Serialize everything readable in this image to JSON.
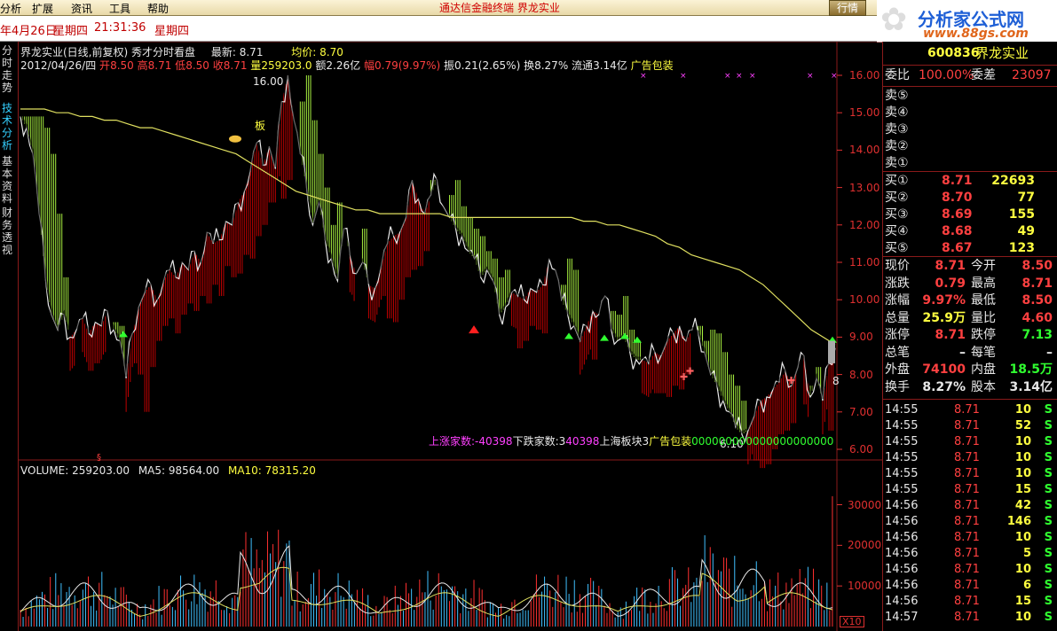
{
  "menu": {
    "items": [
      "分析",
      "扩展",
      "资讯",
      "工具",
      "帮助"
    ],
    "center_title": "通达信金融终端 界龙实业",
    "quote_button": "行情"
  },
  "statusbar": {
    "date": "年4月26日",
    "weekday": "星期四",
    "time": "21:31:36",
    "weekday2": "星期四"
  },
  "logo": {
    "title": "分析家公式网",
    "url": "www.88gs.com"
  },
  "left_tabs": [
    {
      "label": "分时走势",
      "active": false
    },
    {
      "label": "技术分析",
      "active": true
    },
    {
      "label": "基本资料",
      "active": false
    },
    {
      "label": "财务透视",
      "active": false
    }
  ],
  "chart_header": {
    "line1": {
      "name": "界龙实业(日线,前复权)",
      "indicator": "秀才分时看盘",
      "latest_label": "最新:",
      "latest": "8.71",
      "avg_label": "均价:",
      "avg": "8.70"
    },
    "line2": {
      "date": "2012/04/26/四",
      "open_label": "开",
      "open": "8.50",
      "high_label": "高",
      "high": "8.71",
      "low_label": "低",
      "low": "8.50",
      "close_label": "收",
      "close": "8.71",
      "vol_label": "量",
      "vol": "259203.0",
      "amt_label": "额",
      "amt": "2.26亿",
      "chg_label": "幅",
      "chg": "0.79(9.97%)",
      "amp_label": "振",
      "amp": "0.21(2.65%)",
      "turn_label": "换",
      "turn": "8.27%",
      "float_label": "流通",
      "float": "3.14亿",
      "sector": "广告包装"
    }
  },
  "chart_labels": {
    "peak": "16.00",
    "trough": "6.10",
    "last_right": "8",
    "board": "板",
    "bottom_text": "上涨家数:-403981 下跌家数:-403981 上海板块:-4039817 广告包装:000000000000000",
    "bottom_parts": [
      "上涨家数:-40398",
      "下跌家数:3",
      "40398",
      "上海板块",
      "3",
      "广告包装",
      "000000",
      "000000000000000"
    ]
  },
  "price_axis": [
    "16.00",
    "15.00",
    "14.00",
    "13.00",
    "12.00",
    "11.00",
    "10.00",
    "9.00",
    "8.00",
    "7.00",
    "6.00"
  ],
  "volume_header": {
    "vol": "VOLUME: 259203.00",
    "ma5": "MA5: 98564.00",
    "ma10": "MA10: 78315.20"
  },
  "volume_axis": [
    "30000",
    "20000",
    "10000"
  ],
  "volume_unit": "X10",
  "chart_data": {
    "type": "line",
    "title": "界龙实业(日线,前复权)",
    "ylim": [
      5.8,
      16.2
    ],
    "close_path": [
      14.9,
      14.6,
      13.9,
      12.3,
      10.6,
      9.6,
      9.2,
      9.6,
      9.0,
      9.2,
      9.5,
      9.1,
      9.4,
      9.3,
      9.7,
      9.2,
      8.9,
      7.9,
      9.1,
      9.8,
      10.2,
      10.4,
      10.0,
      10.5,
      10.8,
      10.6,
      11.0,
      10.8,
      11.3,
      11.0,
      11.8,
      11.5,
      11.6,
      12.1,
      12.0,
      12.6,
      12.9,
      13.5,
      14.2,
      13.6,
      14.1,
      13.5,
      15.3,
      16.0,
      14.8,
      13.9,
      13.0,
      12.0,
      12.6,
      11.6,
      11.1,
      10.5,
      11.9,
      11.2,
      10.7,
      11.0,
      10.4,
      10.3,
      10.9,
      11.5,
      11.7,
      11.8,
      12.2,
      13.2,
      12.7,
      12.3,
      12.8,
      13.2,
      12.5,
      12.2,
      11.9,
      11.7,
      11.3,
      11.1,
      10.6,
      10.8,
      10.5,
      9.6,
      9.8,
      10.2,
      10.1,
      10.0,
      10.3,
      10.2,
      10.4,
      11.1,
      10.8,
      10.0,
      9.6,
      9.3,
      8.9,
      9.3,
      9.7,
      9.6,
      10.1,
      9.2,
      8.9,
      9.0,
      8.6,
      8.4,
      8.4,
      8.3,
      8.6,
      8.5,
      8.9,
      9.1,
      9.3,
      8.9,
      9.2,
      9.1,
      8.6,
      8.0,
      7.7,
      7.3,
      7.0,
      6.6,
      6.4,
      6.5,
      6.9,
      7.3,
      7.4,
      7.6,
      7.8,
      8.1,
      7.7,
      8.2,
      8.5,
      7.4,
      7.9,
      7.3,
      8.3,
      8.71
    ],
    "ma_path": [
      15.1,
      15.1,
      15.1,
      15.0,
      15.0,
      14.9,
      14.9,
      14.8,
      14.8,
      14.7,
      14.6,
      14.6,
      14.5,
      14.4,
      14.3,
      14.2,
      14.1,
      14.0,
      13.9,
      13.7,
      13.5,
      13.3,
      13.1,
      12.9,
      12.8,
      12.7,
      12.6,
      12.5,
      12.4,
      12.4,
      12.3,
      12.3,
      12.3,
      12.3,
      12.3,
      12.3,
      12.2,
      12.2,
      12.2,
      12.2,
      12.2,
      12.2,
      12.2,
      12.2,
      12.2,
      12.2,
      12.2,
      12.1,
      12.1,
      12.0,
      12.0,
      11.9,
      11.8,
      11.7,
      11.5,
      11.4,
      11.2,
      11.1,
      11.0,
      10.9,
      10.8,
      10.6,
      10.4,
      10.1,
      9.8,
      9.5,
      9.2,
      9.0,
      8.8
    ],
    "volume_ylim": [
      0,
      36000
    ],
    "markers": {
      "buy_arrows": [
        "green"
      ],
      "sell_flags": [
        "red"
      ]
    }
  },
  "right_panel": {
    "code": "600836",
    "name": "界龙实业",
    "wei_bi_label": "委比",
    "wei_bi": "100.00%",
    "wei_cha_label": "委差",
    "wei_cha": "23097",
    "sells": [
      {
        "label": "卖⑤",
        "price": "",
        "vol": ""
      },
      {
        "label": "卖④",
        "price": "",
        "vol": ""
      },
      {
        "label": "卖③",
        "price": "",
        "vol": ""
      },
      {
        "label": "卖②",
        "price": "",
        "vol": ""
      },
      {
        "label": "卖①",
        "price": "",
        "vol": ""
      }
    ],
    "buys": [
      {
        "label": "买①",
        "price": "8.71",
        "vol": "22693"
      },
      {
        "label": "买②",
        "price": "8.70",
        "vol": "77"
      },
      {
        "label": "买③",
        "price": "8.69",
        "vol": "155"
      },
      {
        "label": "买④",
        "price": "8.68",
        "vol": "49"
      },
      {
        "label": "买⑤",
        "price": "8.67",
        "vol": "123"
      }
    ],
    "stats": [
      {
        "l1": "现价",
        "v1": "8.71",
        "c1": "red",
        "l2": "今开",
        "v2": "8.50",
        "c2": "red"
      },
      {
        "l1": "涨跌",
        "v1": "0.79",
        "c1": "red",
        "l2": "最高",
        "v2": "8.71",
        "c2": "red"
      },
      {
        "l1": "涨幅",
        "v1": "9.97%",
        "c1": "red",
        "l2": "最低",
        "v2": "8.50",
        "c2": "red"
      },
      {
        "l1": "总量",
        "v1": "25.9万",
        "c1": "yellow",
        "l2": "量比",
        "v2": "4.60",
        "c2": "red"
      },
      {
        "l1": "涨停",
        "v1": "8.71",
        "c1": "red",
        "l2": "跌停",
        "v2": "7.13",
        "c2": "green"
      },
      {
        "l1": "总笔",
        "v1": "–",
        "c1": "white",
        "l2": "每笔",
        "v2": "–",
        "c2": "white"
      },
      {
        "l1": "外盘",
        "v1": "74100",
        "c1": "red",
        "l2": "内盘",
        "v2": "18.5万",
        "c2": "green"
      },
      {
        "l1": "换手",
        "v1": "8.27%",
        "c1": "white",
        "l2": "股本",
        "v2": "3.14亿",
        "c2": "white"
      }
    ],
    "ticks": [
      {
        "t": "14:55",
        "p": "8.71",
        "v": "10",
        "s": "S"
      },
      {
        "t": "14:55",
        "p": "8.71",
        "v": "52",
        "s": "S"
      },
      {
        "t": "14:55",
        "p": "8.71",
        "v": "10",
        "s": "S"
      },
      {
        "t": "14:55",
        "p": "8.71",
        "v": "10",
        "s": "S"
      },
      {
        "t": "14:55",
        "p": "8.71",
        "v": "10",
        "s": "S"
      },
      {
        "t": "14:55",
        "p": "8.71",
        "v": "15",
        "s": "S"
      },
      {
        "t": "14:56",
        "p": "8.71",
        "v": "42",
        "s": "S"
      },
      {
        "t": "14:56",
        "p": "8.71",
        "v": "146",
        "s": "S"
      },
      {
        "t": "14:56",
        "p": "8.71",
        "v": "10",
        "s": "S"
      },
      {
        "t": "14:56",
        "p": "8.71",
        "v": "5",
        "s": "S"
      },
      {
        "t": "14:56",
        "p": "8.71",
        "v": "10",
        "s": "S"
      },
      {
        "t": "14:56",
        "p": "8.71",
        "v": "6",
        "s": "S"
      },
      {
        "t": "14:56",
        "p": "8.71",
        "v": "15",
        "s": "S"
      },
      {
        "t": "14:57",
        "p": "8.71",
        "v": "10",
        "s": "S"
      }
    ]
  },
  "colors": {
    "up": "#ff3030",
    "down": "#30d0ff",
    "ma": "#e0e060",
    "fill_green": "#a8f040",
    "fill_red": "#c00000",
    "axis": "#e03030"
  }
}
